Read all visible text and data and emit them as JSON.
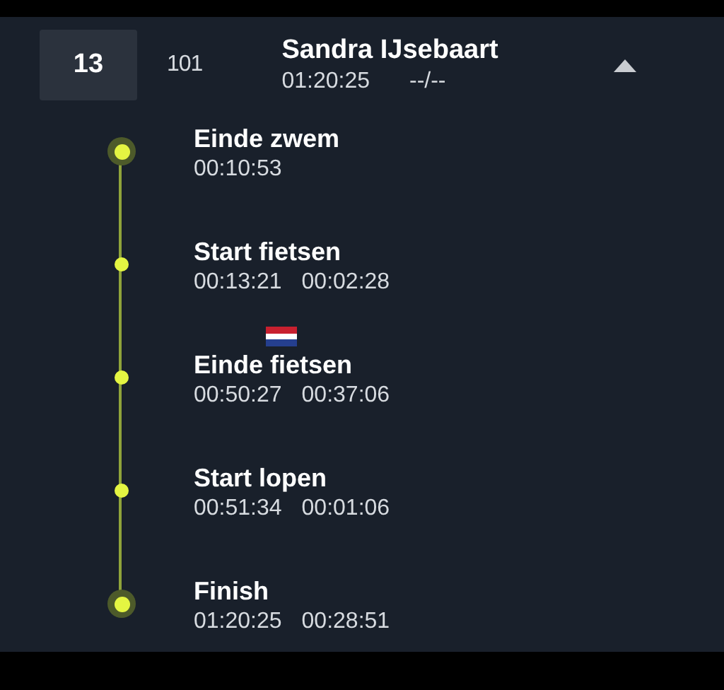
{
  "athlete": {
    "rank": "13",
    "bib": "101",
    "name": "Sandra IJsebaart",
    "total_time": "01:20:25",
    "extra": "--/--",
    "expanded": true
  },
  "splits": [
    {
      "kind": "end",
      "label": "Einde zwem",
      "times": [
        "00:10:53"
      ]
    },
    {
      "kind": "mid",
      "label": "Start fietsen",
      "times": [
        "00:13:21",
        "00:02:28"
      ]
    },
    {
      "kind": "mid",
      "label": "Einde fietsen",
      "times": [
        "00:50:27",
        "00:37:06"
      ],
      "flag": true
    },
    {
      "kind": "mid",
      "label": "Start lopen",
      "times": [
        "00:51:34",
        "00:01:06"
      ]
    },
    {
      "kind": "end",
      "label": "Finish",
      "times": [
        "01:20:25",
        "00:28:51"
      ]
    }
  ]
}
